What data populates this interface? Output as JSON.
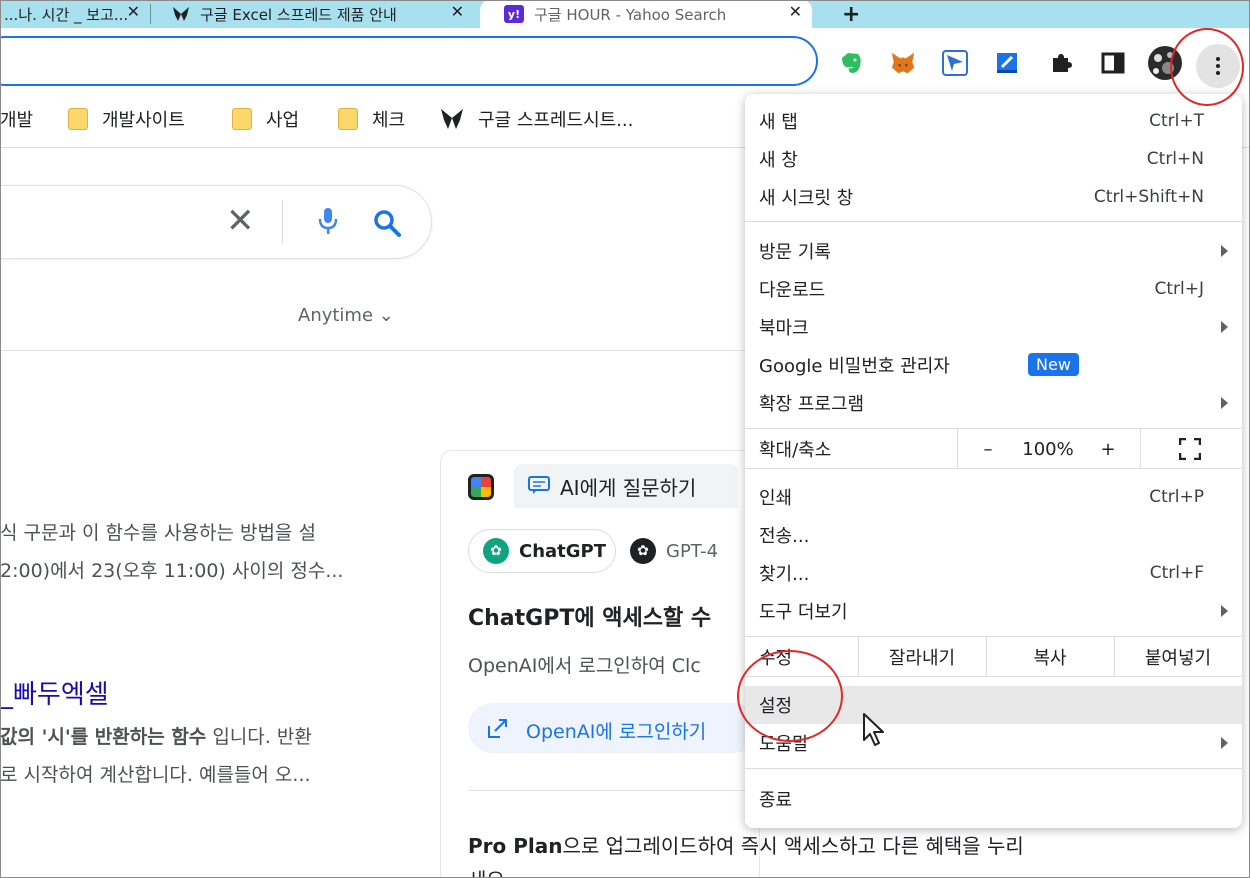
{
  "tabs": [
    {
      "label": "...나. 시간 _ 보고...",
      "active": false
    },
    {
      "label": "구글 Excel 스프레드 제품 안내",
      "active": false
    },
    {
      "label": "구글 HOUR - Yahoo Search",
      "active": true
    }
  ],
  "new_tab_label": "+",
  "toolbar": {
    "extensions": [
      "evernote-icon",
      "metamask-icon",
      "send-icon",
      "bookmark-manager-icon",
      "puzzle-icon",
      "sidepanel-icon",
      "profile-avatar"
    ],
    "menu_button": "more-vert-icon"
  },
  "bookmarks": [
    {
      "label": "개발",
      "folder": false
    },
    {
      "label": "개발사이트",
      "folder": true
    },
    {
      "label": "사업",
      "folder": true
    },
    {
      "label": "체크",
      "folder": true
    },
    {
      "label": "구글 스프레드시트...",
      "folder": false
    }
  ],
  "search": {
    "clear_glyph": "✕",
    "anytime_label": "Anytime ⌄"
  },
  "results": {
    "line1": "식 구문과 이 함수를 사용하는 방법을 설",
    "line2": "2:00)에서 23(오후 11:00) 사이의 정수...",
    "link": "_빠두엑셀",
    "line3_prefix": "값의 '시'를 반환하는 함수",
    "line3_suffix": " 입니다. 반환",
    "line4": "로 시작하여 계산합니다. 예를들어 오..."
  },
  "ai_card": {
    "tab_label": "AI에게 질문하기",
    "model1": "ChatGPT",
    "model2": "GPT-4",
    "title": "ChatGPT에 액세스할 수",
    "subtitle": "OpenAI에서 로그인하여 Clc",
    "login_label": "OpenAI에 로그인하기",
    "pro_bold": "Pro Plan",
    "pro_rest": "으로 업그레이드하여 즉시 액세스하고 다른 혜택을 누리",
    "pro_line2": "세요"
  },
  "menu": {
    "new_tab": {
      "label": "새 탭",
      "shortcut": "Ctrl+T"
    },
    "new_window": {
      "label": "새 창",
      "shortcut": "Ctrl+N"
    },
    "incognito": {
      "label": "새 시크릿 창",
      "shortcut": "Ctrl+Shift+N"
    },
    "history": {
      "label": "방문 기록"
    },
    "downloads": {
      "label": "다운로드",
      "shortcut": "Ctrl+J"
    },
    "bookmarks": {
      "label": "북마크"
    },
    "passwords": {
      "label": "Google 비밀번호 관리자",
      "badge": "New"
    },
    "extensions": {
      "label": "확장 프로그램"
    },
    "zoom": {
      "label": "확대/축소",
      "minus": "–",
      "value": "100%",
      "plus": "+"
    },
    "print": {
      "label": "인쇄",
      "shortcut": "Ctrl+P"
    },
    "cast": {
      "label": "전송..."
    },
    "find": {
      "label": "찾기...",
      "shortcut": "Ctrl+F"
    },
    "more_tools": {
      "label": "도구 더보기"
    },
    "edit": {
      "label": "수정",
      "cut": "잘라내기",
      "copy": "복사",
      "paste": "붙여넣기"
    },
    "settings": {
      "label": "설정"
    },
    "help": {
      "label": "도움말"
    },
    "exit": {
      "label": "종료"
    }
  },
  "colors": {
    "annotation_red": "#e32626",
    "accent_blue": "#1a73e8",
    "tabstrip": "#a9e0ef"
  }
}
